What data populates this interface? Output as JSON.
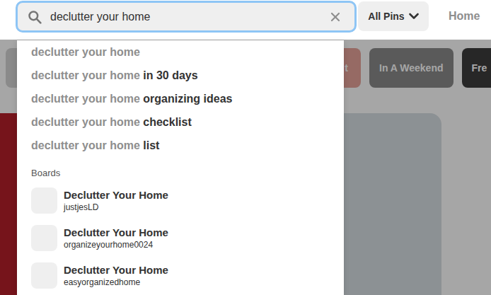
{
  "search": {
    "query": "declutter your home"
  },
  "scope_button": {
    "label": "All Pins"
  },
  "nav": [
    {
      "label": "Home"
    }
  ],
  "guided_chips": [
    {
      "label": "",
      "color": "#d4d4d4"
    },
    {
      "label": "t",
      "color": "#e6a39a"
    },
    {
      "label": "In A Weekend",
      "color": "#8a8a8a"
    },
    {
      "label": "Fre",
      "color": "#3d3d3d"
    }
  ],
  "pins": [
    {
      "color": "#b5202a"
    },
    {
      "color": "#e9e9e9"
    },
    {
      "color": "#d8dfe3"
    },
    {
      "color": "#ffffff"
    }
  ],
  "suggestions": [
    {
      "prefix": "declutter your home",
      "suffix": ""
    },
    {
      "prefix": "declutter your home",
      "suffix": " in 30 days"
    },
    {
      "prefix": "declutter your home",
      "suffix": " organizing ideas"
    },
    {
      "prefix": "declutter your home",
      "suffix": " checklist"
    },
    {
      "prefix": "declutter your home",
      "suffix": " list"
    }
  ],
  "boards_heading": "Boards",
  "boards": [
    {
      "title": "Declutter Your Home",
      "owner": "justjesLD"
    },
    {
      "title": "Declutter Your Home",
      "owner": "organizeyourhome0024"
    },
    {
      "title": "Declutter Your Home",
      "owner": "easyorganizedhome"
    }
  ]
}
